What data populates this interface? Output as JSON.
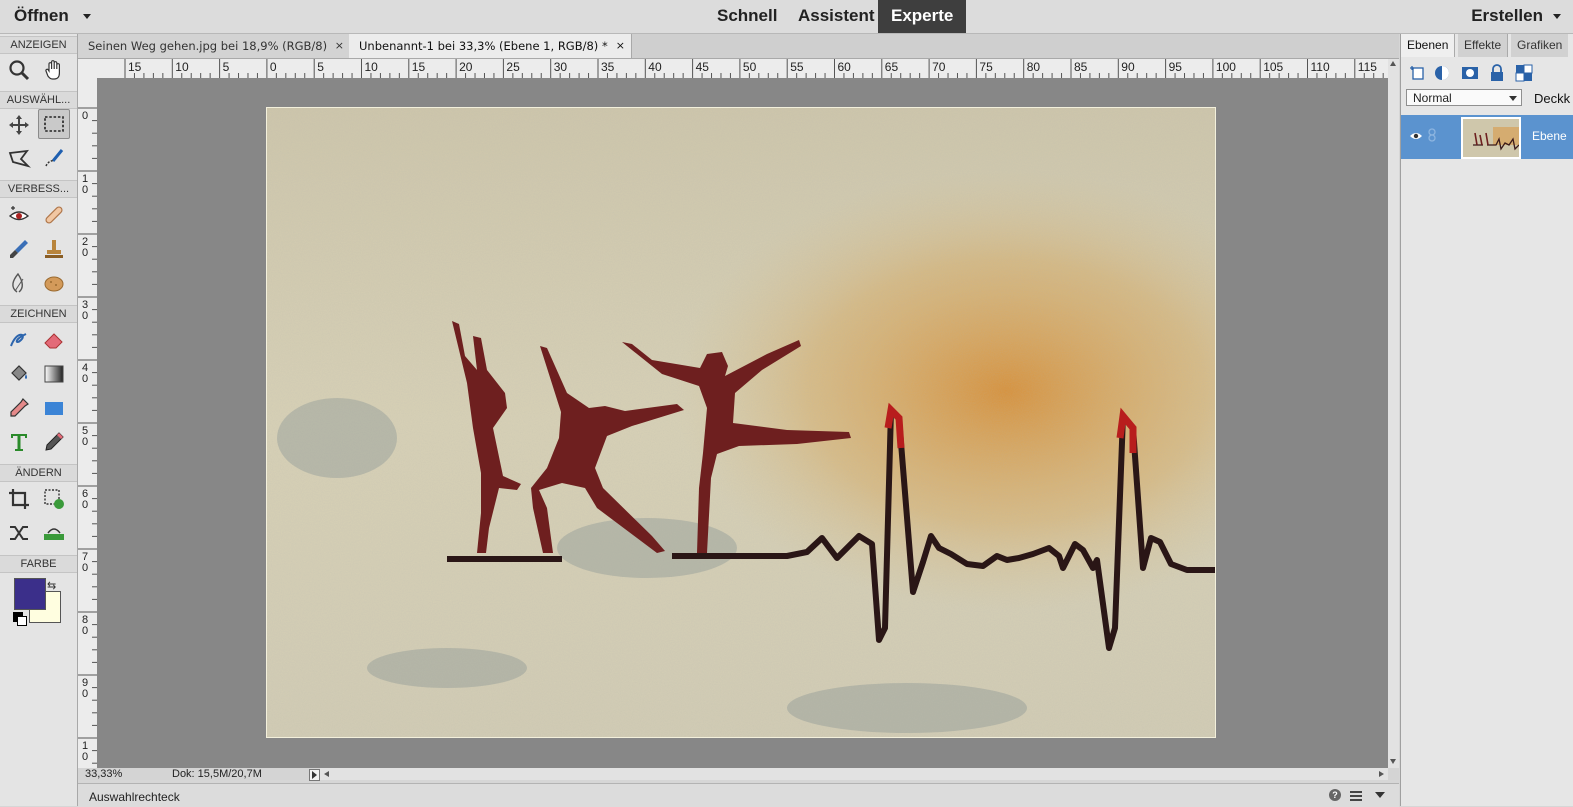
{
  "menu": {
    "open": "Öffnen",
    "create": "Erstellen"
  },
  "modes": [
    {
      "label": "Schnell",
      "active": false
    },
    {
      "label": "Assistent",
      "active": false
    },
    {
      "label": "Experte",
      "active": true
    }
  ],
  "toolbox": {
    "sections": [
      "ANZEIGEN",
      "AUSWÄHL...",
      "VERBESS...",
      "ZEICHNEN",
      "ÄNDERN",
      "FARBE"
    ],
    "foreground_color": "#3b2f8a",
    "background_color": "#fffee0"
  },
  "documents": [
    {
      "title": "Seinen Weg gehen.jpg bei 18,9% (RGB/8)",
      "close": "×",
      "active": false
    },
    {
      "title": "Unbenannt-1 bei 33,3% (Ebene 1, RGB/8) *",
      "close": "×",
      "active": true
    }
  ],
  "ruler": {
    "top": [
      "15",
      "10",
      "5",
      "0",
      "5",
      "10",
      "15",
      "20",
      "25",
      "30",
      "35",
      "40",
      "45",
      "50",
      "55",
      "60",
      "65",
      "70",
      "75",
      "80",
      "85",
      "90",
      "95",
      "100",
      "105",
      "110",
      "115"
    ],
    "left": [
      "0",
      "10",
      "20",
      "30",
      "40",
      "50",
      "60",
      "70",
      "80",
      "90",
      "10"
    ]
  },
  "status": {
    "zoom": "33,33%",
    "doc": "Dok: 15,5M/20,7M"
  },
  "bottom": {
    "tool_name": "Auswahlrechteck"
  },
  "panel": {
    "tabs": [
      {
        "label": "Ebenen",
        "active": true
      },
      {
        "label": "Effekte",
        "active": false
      },
      {
        "label": "Grafiken",
        "active": false
      }
    ],
    "blend_mode": "Normal",
    "opacity_label": "Deckk",
    "layer_name": "Ebene"
  }
}
